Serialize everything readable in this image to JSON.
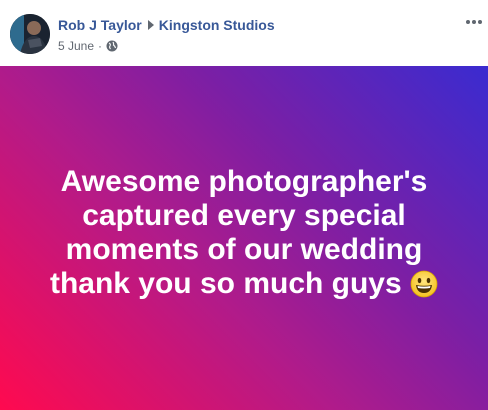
{
  "post": {
    "author": "Rob J Taylor",
    "page": "Kingston Studios",
    "date": "5 June",
    "separator": "·",
    "privacy_icon": "globe-icon",
    "more_icon": "more-options-icon",
    "message": "Awesome photographer's captured every special moments of our wedding thank you so much guys",
    "emoji_icon": "grinning-face-emoji",
    "gradient_colors": [
      "#ff0a4f",
      "#b11b8a",
      "#7b1fa5",
      "#3a2bd0"
    ],
    "link_color": "#385898"
  }
}
